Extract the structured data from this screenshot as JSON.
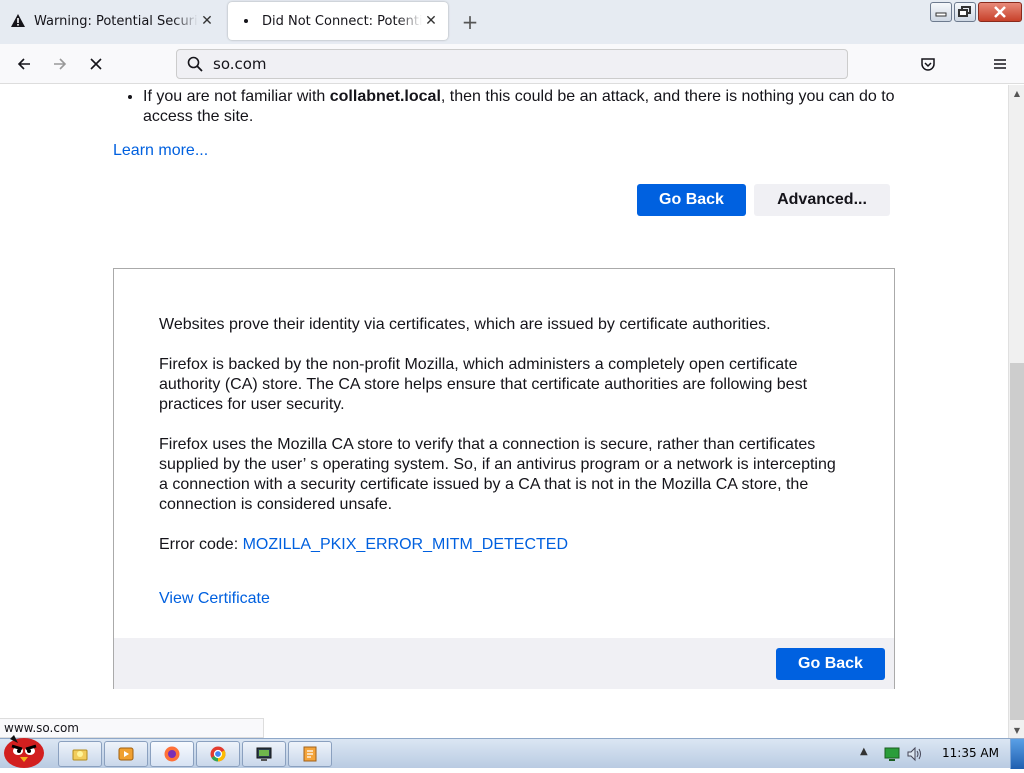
{
  "browser": {
    "tabs": [
      {
        "title": "Warning: Potential Security Risk Ahead",
        "close": "✕"
      },
      {
        "title": "Did Not Connect: Potential Security Issue",
        "close": "✕"
      }
    ],
    "new_tab": "+",
    "url": "so.com"
  },
  "page": {
    "bullet_prefix": "If you are not familiar with ",
    "bullet_host": "collabnet.local",
    "bullet_suffix": ", then this could be an attack, and there is nothing you can do to access the site.",
    "learn_more": "Learn more...",
    "go_back": "Go Back",
    "advanced": "Advanced...",
    "advanced_panel": {
      "p1": "Websites prove their identity via certificates, which are issued by certificate authorities.",
      "p2": "Firefox is backed by the non-profit Mozilla, which administers a completely open certificate authority (CA) store. The CA store helps ensure that certificate authorities are following best practices for user security.",
      "p3": "Firefox uses the Mozilla CA store to verify that a connection is secure, rather than certificates supplied by the user’ s operating system. So, if an antivirus program or a network is intercepting a connection with a security certificate issued by a CA that is not in the Mozilla CA store, the connection is considered unsafe.",
      "error_label": "Error code: ",
      "error_code": "MOZILLA_PKIX_ERROR_MITM_DETECTED",
      "view_certificate": "View Certificate",
      "go_back": "Go Back"
    }
  },
  "status_url": "www.so.com",
  "taskbar": {
    "clock": "11:35 AM"
  },
  "colors": {
    "primary_button": "#0061e0",
    "link": "#0060df"
  }
}
